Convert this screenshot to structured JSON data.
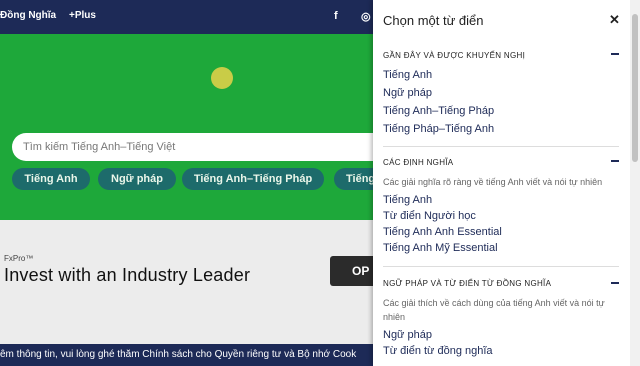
{
  "nav": {
    "links": [
      "Đồng Nghĩa",
      "+Plus"
    ],
    "social_icons": [
      "facebook-icon",
      "instagram-icon"
    ]
  },
  "search": {
    "placeholder": "Tìm kiếm Tiếng Anh–Tiếng Việt"
  },
  "pills": [
    "Tiếng Anh",
    "Ngữ pháp",
    "Tiếng Anh–Tiếng Pháp",
    "Tiếng"
  ],
  "ad": {
    "brand": "FxPro",
    "headline": "Invest with an Industry Leader",
    "cta": "OP"
  },
  "cookie_bar": {
    "text": "êm thông tin, vui lòng ghé thăm Chính sách cho Quyền riêng tư và Bộ nhớ Cook"
  },
  "panel": {
    "title": "Chọn một từ điển",
    "close_icon": "close-icon",
    "sections": [
      {
        "title": "GẦN ĐÂY VÀ ĐƯỢC KHUYẾN NGHỊ",
        "description": "",
        "items": [
          "Tiếng Anh",
          "Ngữ pháp",
          "Tiếng Anh–Tiếng Pháp",
          "Tiếng Pháp–Tiếng Anh"
        ]
      },
      {
        "title": "CÁC ĐỊNH NGHĨA",
        "description": "Các giải nghĩa rõ ràng về tiếng Anh viết và nói tự nhiên",
        "items": [
          "Tiếng Anh",
          "Từ điển Người học",
          "Tiếng Anh Anh Essential",
          "Tiếng Anh Mỹ Essential"
        ]
      },
      {
        "title": "NGỮ PHÁP VÀ TỪ ĐIỂN TỪ ĐỒNG NGHĨA",
        "description": "Các giải thích về cách dùng của tiếng Anh viết và nói tự nhiên",
        "items": [
          "Ngữ pháp",
          "Từ điển từ đồng nghĩa"
        ]
      }
    ]
  },
  "colors": {
    "navy": "#1d2a57",
    "hero_green": "#1ea83a",
    "pill": "#1d6b6b"
  }
}
